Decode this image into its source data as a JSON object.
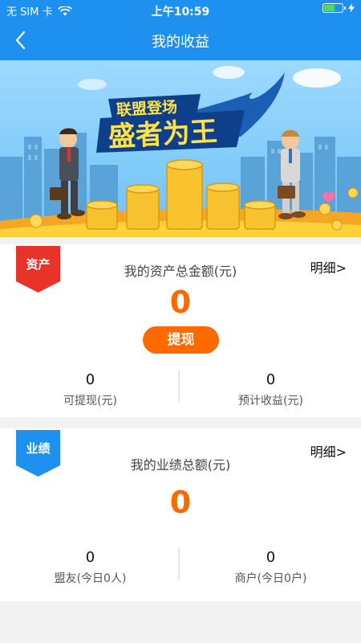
{
  "status_bar": {
    "carrier": "无 SIM 卡",
    "time": "上午10:59"
  },
  "nav": {
    "title": "我的收益"
  },
  "banner": {
    "line1": "联盟登场",
    "line2": "盛者为王"
  },
  "assets": {
    "badge": "资产",
    "detail_link": "明细>",
    "total_label": "我的资产总金额(元)",
    "total_value": "0",
    "withdraw_label": "提现",
    "withdrawable_value": "0",
    "withdrawable_label": "可提现(元)",
    "expected_value": "0",
    "expected_label": "预计收益(元)"
  },
  "performance": {
    "badge": "业绩",
    "detail_link": "明细>",
    "total_label": "我的业绩总额(元)",
    "total_value": "0",
    "allies_value": "0",
    "allies_label": "盟友(今日0人)",
    "merchants_value": "0",
    "merchants_label": "商户(今日0户)"
  },
  "colors": {
    "primary": "#1E90F0",
    "accent": "#FF6A00",
    "assets_badge": "#E8332A",
    "performance_badge": "#1E90F0"
  }
}
